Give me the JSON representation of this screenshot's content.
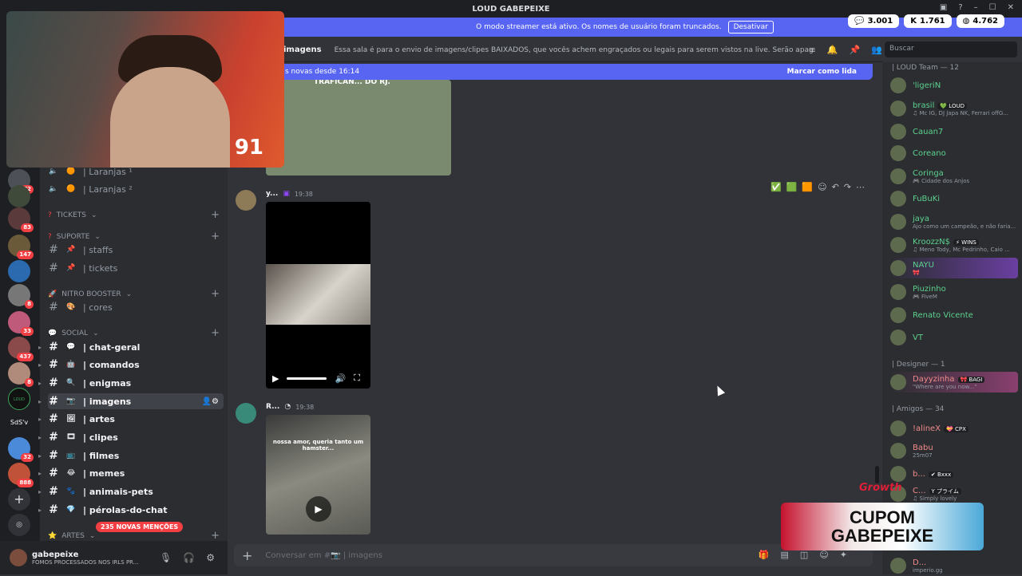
{
  "window": {
    "title": "LOUD GABEPEIXE"
  },
  "streamer_banner": {
    "text": "O modo streamer está ativo. Os nomes de usuário foram truncados.",
    "button": "Desativar"
  },
  "stats": [
    {
      "icon": "chat-bubble-icon",
      "value": "3.001"
    },
    {
      "icon": "kick-logo-icon",
      "value": "1.761"
    },
    {
      "icon": "globe-icon",
      "value": "4.762"
    }
  ],
  "guild_badges": [
    "72",
    "83",
    "147",
    "8",
    "33",
    "437",
    "8",
    "32",
    "888"
  ],
  "guild_labels": {
    "loud": "LOUD",
    "sdsv": "SdS'v"
  },
  "sidebar": {
    "channels_top": [
      {
        "emoji": "🟠",
        "label": "| Laranjas ¹"
      },
      {
        "emoji": "🟠",
        "label": "| Laranjas ²"
      }
    ],
    "categories": {
      "tickets": "TICKETS",
      "suporte": "SUPORTE",
      "nitro": "NITRO BOOSTER",
      "social": "SOCIAL",
      "artes": "ARTES"
    },
    "suporte_channels": [
      "| staffs",
      "| tickets"
    ],
    "nitro_channels": [
      "| cores"
    ],
    "social_channels": [
      "| chat-geral",
      "| comandos",
      "| enigmas",
      "| imagens",
      "| artes",
      "| clipes",
      "| filmes",
      "| memes",
      "| animais-pets",
      "| pérolas-do-chat"
    ],
    "mentions_badge": "235 NOVAS MENÇÕES"
  },
  "user": {
    "name": "gabepeixe",
    "status": "FOMOS PROCESSADOS NOS IRLS PR..."
  },
  "channel": {
    "name": "imagens",
    "topic": "Essa sala é para o envio de imagens/clipes BAIXADOS, que vocês achem engraçados ou legais para serem vistos na live. Serão apagados prints de ou..."
  },
  "search": {
    "placeholder": "Buscar"
  },
  "new_messages": {
    "text": "s novas desde 16:14",
    "mark_read": "Marcar como lida"
  },
  "messages": [
    {
      "author": "y...",
      "time": "19:38"
    },
    {
      "author": "R...",
      "time": "19:38"
    }
  ],
  "image_overlay": "TRAFICAN... DO RJ.",
  "video2_caption": "nossa amor, queria tanto um hamster...",
  "composer": {
    "placeholder": "Conversar em #📷 | imagens"
  },
  "members": {
    "cat_loud": "| LOUD Team — 12",
    "loud": [
      {
        "name": "'ligeriN",
        "sub": ""
      },
      {
        "name": "brasil",
        "tag": "💚 LOUD",
        "sub": "♫ Mc IG, DJ Japa NK, Ferrari offG..."
      },
      {
        "name": "Cauan7",
        "sub": ""
      },
      {
        "name": "Coreano",
        "sub": ""
      },
      {
        "name": "Coringa",
        "sub": "🎮 Cidade dos Anjos"
      },
      {
        "name": "FuBuKi",
        "sub": ""
      },
      {
        "name": "jaya",
        "sub": "Ajo como um campeão, e não faria..."
      },
      {
        "name": "KroozzN$",
        "tag": "⚡ WINS",
        "sub": "♫ Meno Tody, Mc Pedrinho, Caio ..."
      },
      {
        "name": "NAYU",
        "sub": "🎀"
      },
      {
        "name": "Piuzinho",
        "sub": "🎮 FiveM"
      },
      {
        "name": "Renato Vicente",
        "sub": ""
      },
      {
        "name": "VT",
        "sub": ""
      }
    ],
    "cat_designer": "| Designer — 1",
    "designer": [
      {
        "name": "Dayyzinha",
        "tag": "🎀 BAGI",
        "sub": "\"Where are you now...\""
      }
    ],
    "cat_amigos": "| Amigos — 34",
    "amigos": [
      {
        "name": "!alineX",
        "tag": "💝 CPX",
        "sub": ""
      },
      {
        "name": "Babu",
        "sub": "25m07"
      },
      {
        "name": "b...",
        "tag": "✔ Bxxx",
        "sub": ""
      },
      {
        "name": "C...",
        "tag": "Y プライム",
        "sub": "♫ Simply lovely"
      },
      {
        "name": "D...",
        "sub": "imperio.gg"
      }
    ]
  },
  "overlay": {
    "webcam_number": "91",
    "growth": "Growth",
    "cupom_line1": "CUPOM",
    "cupom_line2": "GABEPEIXE"
  }
}
